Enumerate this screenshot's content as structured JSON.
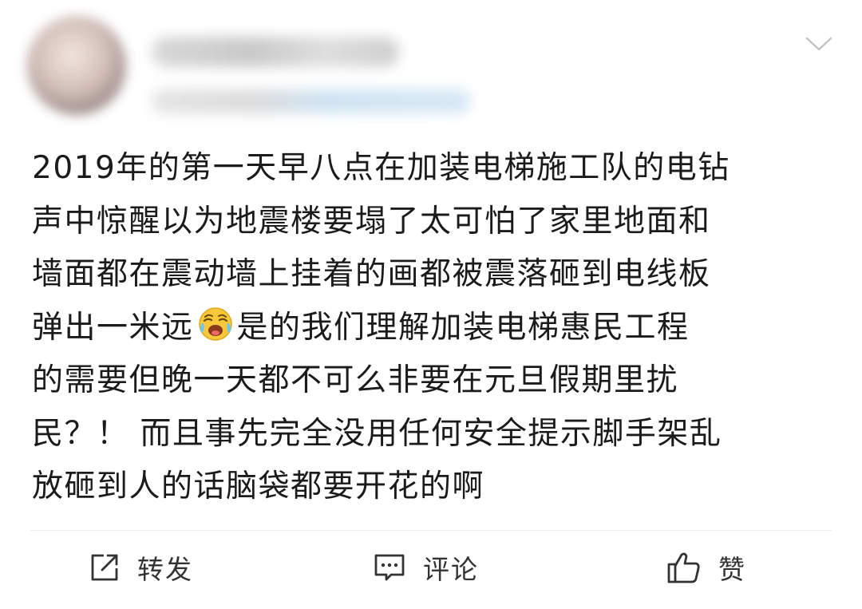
{
  "post": {
    "header": {
      "avatar_icon": "blurred-avatar",
      "menu_icon": "chevron-down-icon"
    },
    "body_lines": [
      "2019年的第一天早八点在加装电梯施工队的电钻",
      "声中惊醒以为地震楼要塌了太可怕了家里地面和",
      "墙面都在震动墙上挂着的画都被震落砸到电线板",
      "弹出一米远",
      "是的我们理解加装电梯惠民工程",
      "的需要但晚一天都不可么非要在元旦假期里扰",
      "民？！ 而且事先完全没用任何安全提示脚手架乱",
      "放砸到人的话脑袋都要开花的啊"
    ],
    "emoji_name": "laughing-crying-emoji"
  },
  "actions": {
    "repost": {
      "label": "转发",
      "icon": "repost-icon"
    },
    "comment": {
      "label": "评论",
      "icon": "comment-icon"
    },
    "like": {
      "label": "赞",
      "icon": "thumbs-up-icon"
    }
  },
  "colors": {
    "text": "#1b1b1b",
    "action_text": "#333333",
    "divider": "#ececec",
    "emoji_face": "#f7c83a"
  }
}
